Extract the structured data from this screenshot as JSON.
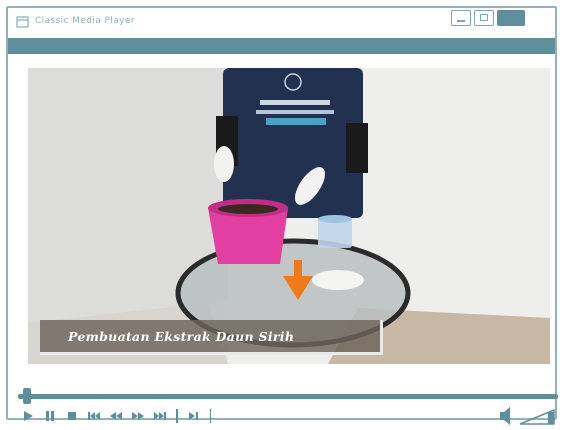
{
  "window": {
    "title": "Classic Media Player"
  },
  "video": {
    "caption": "Pembuatan Ekstrak Daun Sirih",
    "progress_fraction": 0.01
  },
  "icons": {
    "title": "window-icon",
    "minimize": "minimize-icon",
    "maximize": "maximize-icon",
    "close": "close-icon",
    "play": "play-icon",
    "pause": "pause-icon",
    "stop": "stop-icon",
    "skip_back": "skip-back-icon",
    "rewind": "rewind-icon",
    "forward": "fast-forward-icon",
    "skip_forward": "skip-forward-icon",
    "frame": "frame-step-icon",
    "volume": "speaker-icon"
  },
  "colors": {
    "accent": "#5f8f9d",
    "border": "#8fb3bd"
  }
}
